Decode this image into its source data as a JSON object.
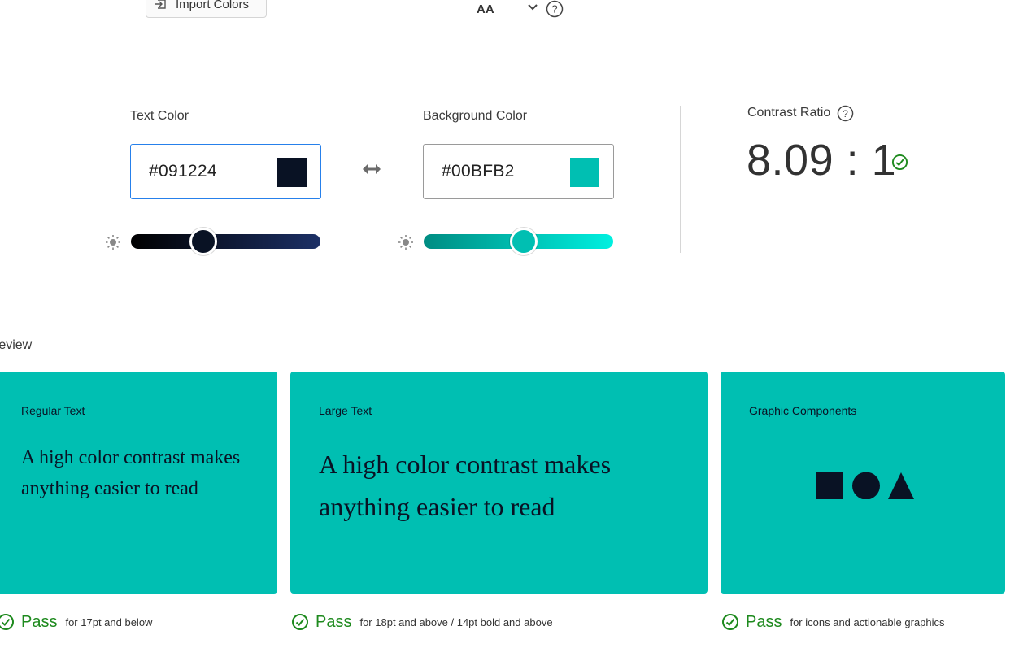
{
  "toolbar": {
    "import_label": "Import Colors",
    "level": "AA"
  },
  "text_color": {
    "label": "Text Color",
    "hex": "#091224",
    "swatch": "#091224",
    "lightness_percent": 38
  },
  "background_color": {
    "label": "Background Color",
    "hex": "#00BFB2",
    "swatch": "#00BFB2",
    "lightness_percent": 53
  },
  "contrast": {
    "label": "Contrast Ratio",
    "value": "8.09 : 1",
    "status_color": "#1e8a1e"
  },
  "preview": {
    "label": "review",
    "cards": [
      {
        "title": "Regular Text",
        "sample": "A high color contrast makes anything easier to read",
        "pass": "Pass",
        "note": "for 17pt and below"
      },
      {
        "title": "Large Text",
        "sample": "A high color contrast makes anything easier to read",
        "pass": "Pass",
        "note": "for 18pt and above / 14pt bold and above"
      },
      {
        "title": "Graphic Components",
        "sample": "",
        "pass": "Pass",
        "note": "for icons and actionable graphics"
      }
    ]
  },
  "icons": {
    "import": "import-icon",
    "chevron": "chevron-down-icon",
    "help": "help-circle-icon",
    "swap": "swap-arrows-icon",
    "brightness": "sun-icon",
    "pass": "check-circle-icon"
  }
}
